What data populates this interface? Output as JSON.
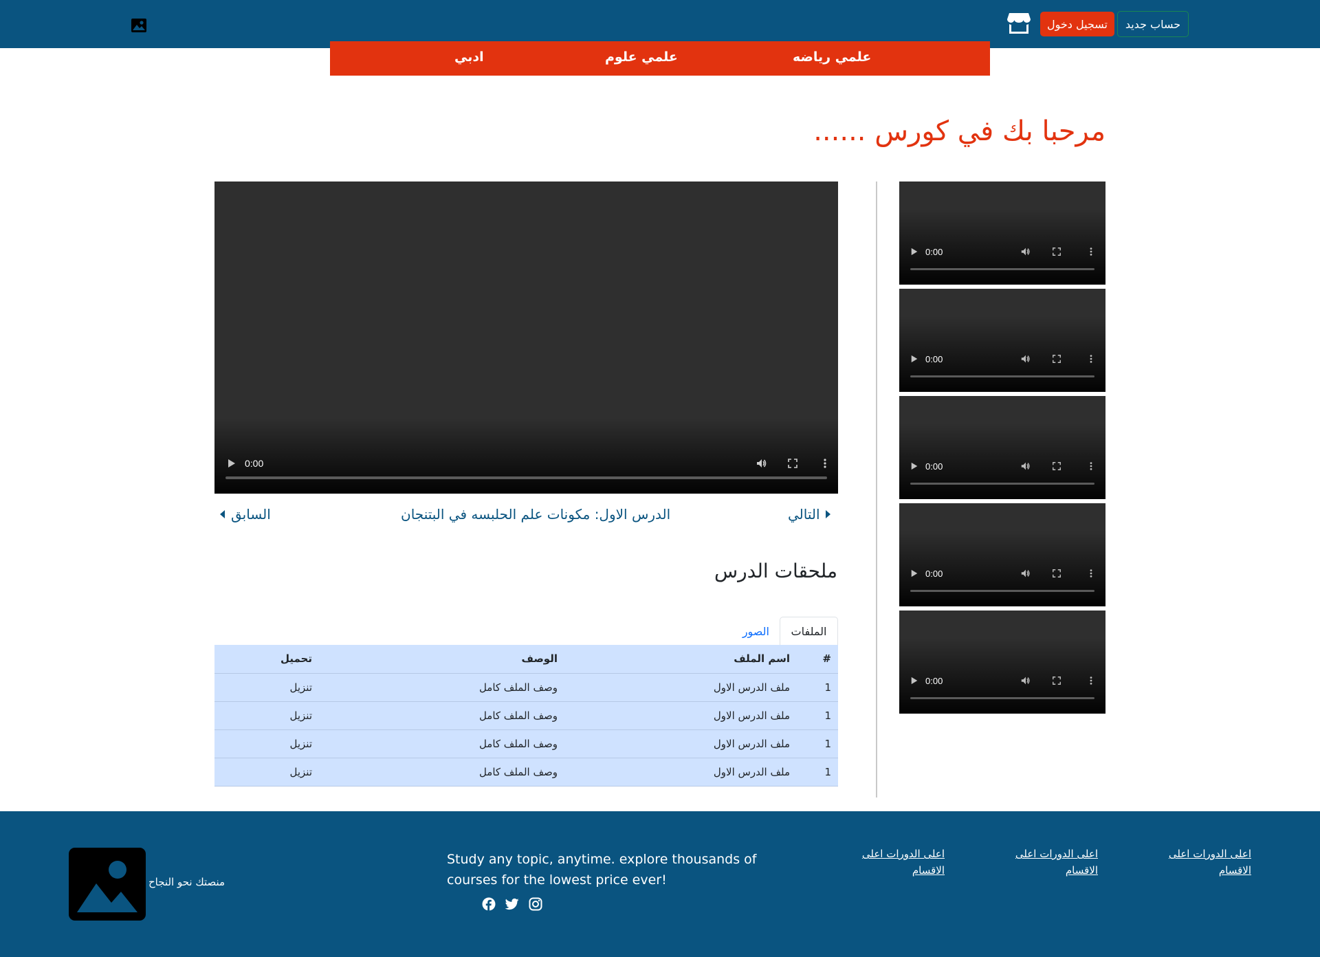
{
  "header": {
    "signup_label": "حساب جديد",
    "login_label": "تسجيل دخول",
    "colors": {
      "bar": "#0a5480",
      "login_bg": "#e2330f",
      "signup_border": "#198754"
    }
  },
  "categories": [
    {
      "label": "علمي رياضه"
    },
    {
      "label": "علمي علوم"
    },
    {
      "label": "ادبي"
    }
  ],
  "welcome": "مرحبا بك في كورس ......",
  "main_video": {
    "time": "0:00"
  },
  "thumbnails": [
    {
      "time": "0:00"
    },
    {
      "time": "0:00"
    },
    {
      "time": "0:00"
    },
    {
      "time": "0:00"
    },
    {
      "time": "0:00"
    }
  ],
  "lesson_nav": {
    "next_label": "التالي",
    "current_lesson": "الدرس الاول: مكونات علم الحلبسه في البتنجان",
    "prev_label": "السابق"
  },
  "attachments": {
    "title": "ملحقات الدرس",
    "tabs": {
      "files": "الملفات",
      "images": "الصور"
    },
    "columns": {
      "num": "#",
      "name": "اسم الملف",
      "desc": "الوصف",
      "download": "تحميل"
    },
    "rows": [
      {
        "num": "1",
        "name": "ملف الدرس الاول",
        "desc": "وصف الملف كامل",
        "download": "تنزيل"
      },
      {
        "num": "1",
        "name": "ملف الدرس الاول",
        "desc": "وصف الملف كامل",
        "download": "تنزيل"
      },
      {
        "num": "1",
        "name": "ملف الدرس الاول",
        "desc": "وصف الملف كامل",
        "download": "تنزيل"
      },
      {
        "num": "1",
        "name": "ملف الدرس الاول",
        "desc": "وصف الملف كامل",
        "download": "تنزيل"
      }
    ]
  },
  "footer": {
    "links": [
      {
        "line1": "اعلى الدورات اعلى",
        "line2": "الاقسام"
      },
      {
        "line1": "اعلى الدورات اعلى",
        "line2": "الاقسام"
      },
      {
        "line1": "اعلى الدورات اعلى",
        "line2": "الاقسام"
      }
    ],
    "tagline": "Study any topic, anytime. explore thousands of courses for the lowest price ever!",
    "slogan": "منصتك نحو النجاح"
  }
}
